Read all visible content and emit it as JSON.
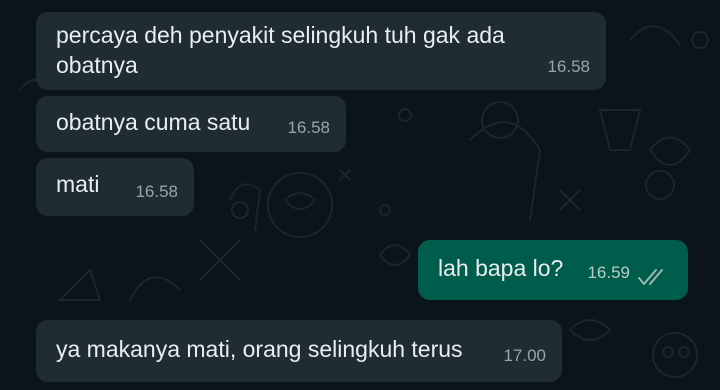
{
  "chat": {
    "messages": [
      {
        "direction": "incoming",
        "text_lines": [
          "percaya deh penyakit selingkuh tuh gak ada",
          "obatnya"
        ],
        "time": "16.58"
      },
      {
        "direction": "incoming",
        "text": "obatnya cuma satu",
        "time": "16.58"
      },
      {
        "direction": "incoming",
        "text": "mati",
        "time": "16.58"
      },
      {
        "direction": "outgoing",
        "text": "lah bapa lo?",
        "time": "16.59",
        "status_icon": "double-check-read-icon"
      },
      {
        "direction": "incoming",
        "text": "ya makanya mati, orang selingkuh terus",
        "time": "17.00"
      }
    ]
  },
  "colors": {
    "background": "#0b141a",
    "incoming_bubble": "#202c33",
    "outgoing_bubble": "#005c4b",
    "text": "#e9edef",
    "timestamp": "#9aa5ab"
  }
}
